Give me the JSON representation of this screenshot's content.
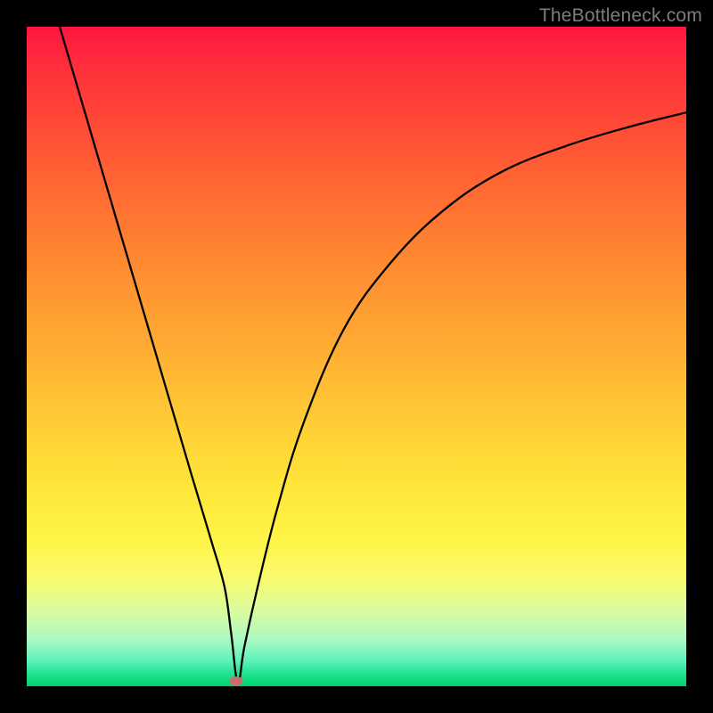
{
  "watermark": "TheBottleneck.com",
  "chart_data": {
    "type": "line",
    "title": "",
    "xlabel": "",
    "ylabel": "",
    "xlim": [
      0,
      100
    ],
    "ylim": [
      0,
      100
    ],
    "grid": false,
    "legend": false,
    "series": [
      {
        "name": "curve",
        "x": [
          5,
          10,
          15,
          20,
          25,
          28,
          30,
          31,
          32,
          33,
          35,
          38,
          42,
          48,
          55,
          63,
          72,
          82,
          92,
          100
        ],
        "values": [
          100,
          83,
          66,
          49,
          32,
          22,
          15,
          8,
          0.5,
          6,
          15,
          27,
          40,
          54,
          64,
          72,
          78,
          82,
          85,
          87
        ]
      }
    ],
    "marker": {
      "x": 31.8,
      "y": 0.8
    },
    "background_gradient": {
      "top": "#ff153f",
      "bottom": "#00d46a"
    },
    "curve_stroke": "#000000",
    "curve_stroke_width": 2.3
  }
}
